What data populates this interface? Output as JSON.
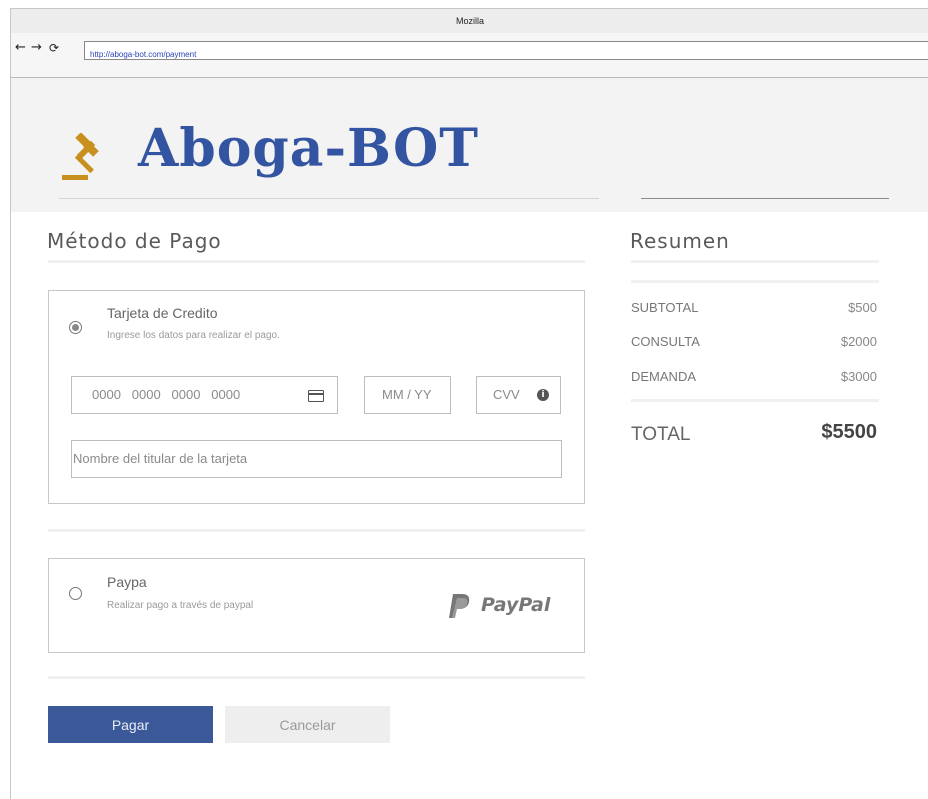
{
  "browser": {
    "title": "Mozilla",
    "url": "http://aboga-bot.com/payment",
    "back_icon": "arrow-left-icon",
    "forward_icon": "arrow-right-icon",
    "reload_icon": "reload-icon"
  },
  "brand": {
    "name": "Aboga-BOT",
    "icon": "gavel-icon",
    "icon_color": "#c8901e",
    "text_color": "#3354a0"
  },
  "payment": {
    "title": "Método de Pago",
    "card_option": {
      "title": "Tarjeta de Credito",
      "subtitle": "Ingrese los datos para realizar el pago.",
      "selected": true,
      "card_number_placeholder": "0000   0000   0000   0000",
      "expiry_placeholder": "MM / YY",
      "cvv_placeholder": "CVV",
      "holder_placeholder": "Nombre del titular de la tarjeta"
    },
    "paypal_option": {
      "title": "Paypa",
      "subtitle": "Realizar pago a través de paypal",
      "logo_text": "PayPal",
      "selected": false
    },
    "pay_button": "Pagar",
    "cancel_button": "Cancelar",
    "primary_color": "#3b5998"
  },
  "summary": {
    "title": "Resumen",
    "rows": [
      {
        "label": "SUBTOTAL",
        "value": "$500"
      },
      {
        "label": "CONSULTA",
        "value": "$2000"
      },
      {
        "label": "DEMANDA",
        "value": "$3000"
      }
    ],
    "total_label": "TOTAL",
    "total_value": "$5500"
  }
}
